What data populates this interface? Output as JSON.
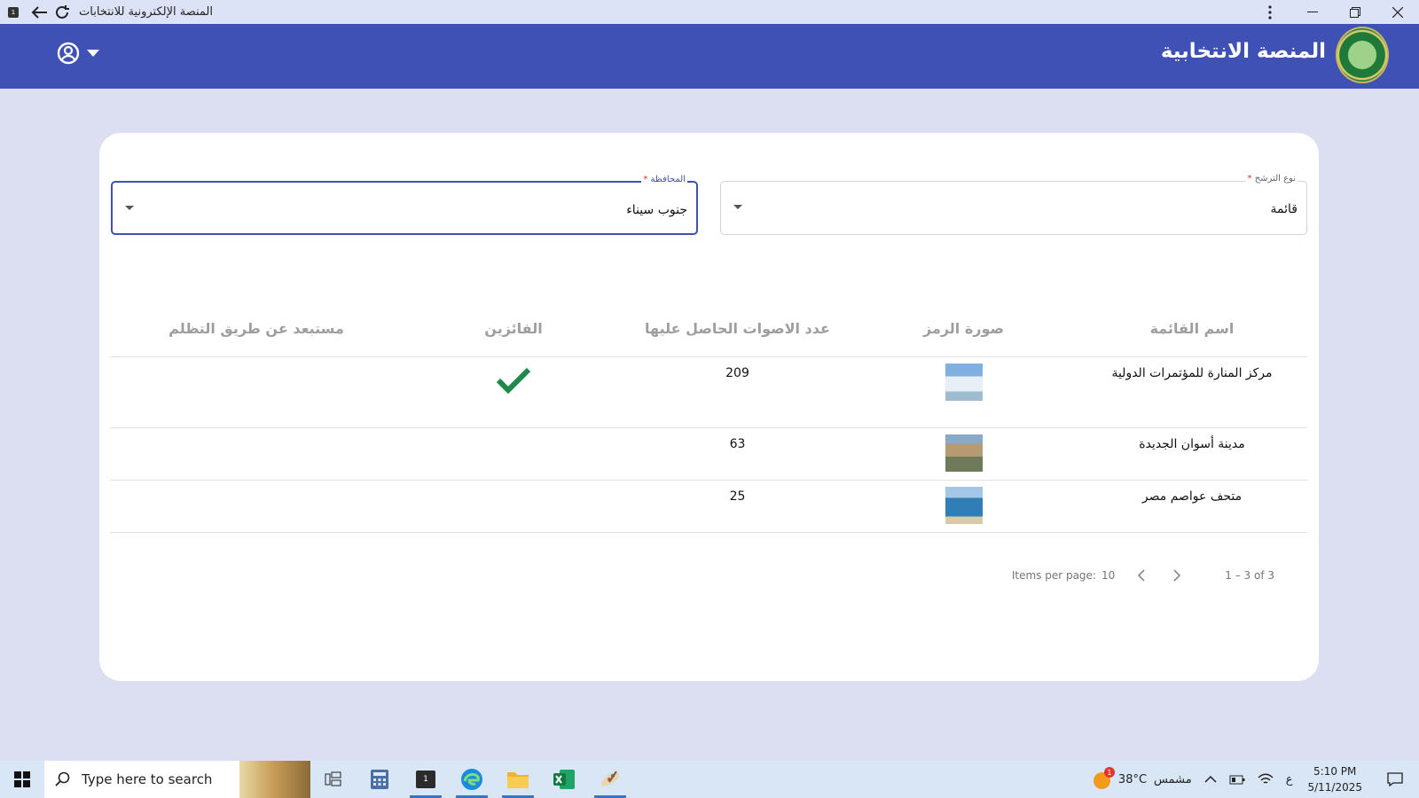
{
  "window": {
    "title": "المنصة الإلكترونية للانتخابات",
    "app_icon_label": "1"
  },
  "header": {
    "app_title": "المنصة الانتخابية"
  },
  "filters": {
    "candidacy_type": {
      "label": "نوع الترشح",
      "required_mark": "*",
      "value": "قائمة"
    },
    "governorate": {
      "label": "المحافظة",
      "required_mark": "*",
      "value": "جنوب سيناء"
    }
  },
  "table": {
    "columns": [
      "اسم القائمة",
      "صورة الرمز",
      "عدد الاصوات الحاصل عليها",
      "الفائزين",
      "مستبعد عن طريق التظلم"
    ],
    "rows": [
      {
        "name": "مركز المنارة للمؤتمرات الدولية",
        "votes": "209",
        "winner": true
      },
      {
        "name": "مدينة أسوان الجديدة",
        "votes": "63",
        "winner": false
      },
      {
        "name": "متحف عواصم مصر",
        "votes": "25",
        "winner": false
      }
    ]
  },
  "paginator": {
    "items_per_page_label": "Items per page:",
    "items_per_page": "10",
    "range_label": "1 – 3 of 3"
  },
  "taskbar": {
    "search_placeholder": "Type here to search",
    "weather": "38°C",
    "weather_desc": "مشمس",
    "weather_badge": "1",
    "language": "ع",
    "time": "5:10 PM",
    "date": "5/11/2025",
    "active_app_label": "1"
  }
}
